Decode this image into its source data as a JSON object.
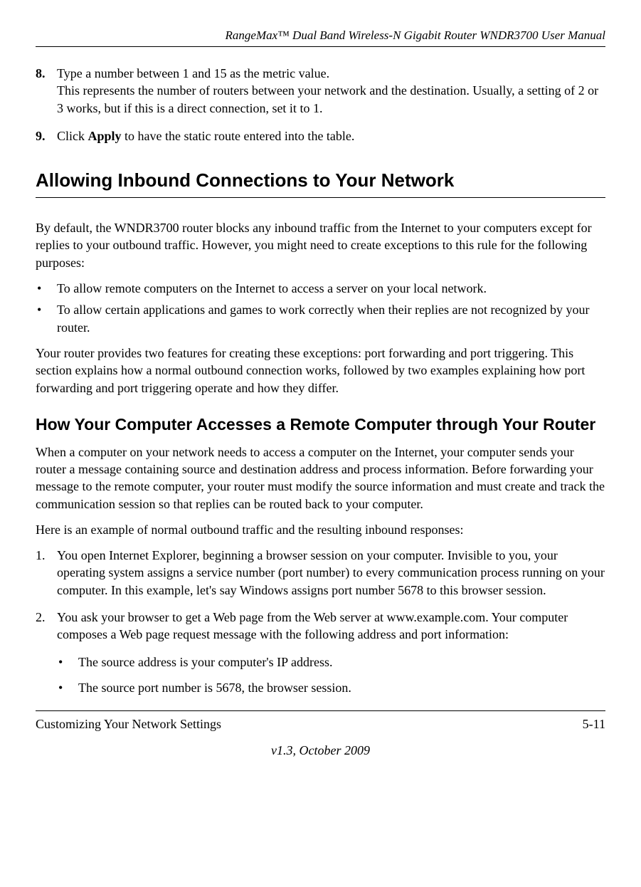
{
  "header": {
    "title": "RangeMax™ Dual Band Wireless-N Gigabit Router WNDR3700 User Manual"
  },
  "steps": {
    "eight": {
      "num": "8.",
      "text": "Type a number between 1 and 15 as the metric value.\nThis represents the number of routers between your network and the destination. Usually, a setting of 2 or 3 works, but if this is a direct connection, set it to 1."
    },
    "nine": {
      "num": "9.",
      "prefix": "Click ",
      "bold": "Apply",
      "suffix": " to have the static route entered into the table."
    }
  },
  "heading1": "Allowing Inbound Connections to Your Network",
  "para1": "By default, the WNDR3700 router blocks any inbound traffic from the Internet to your computers except for replies to your outbound traffic. However, you might need to create exceptions to this rule for the following purposes:",
  "bullets": {
    "b1": "To allow remote computers on the Internet to access a server on your local network.",
    "b2": "To allow certain applications and games to work correctly when their replies are not recognized by your router."
  },
  "para2": "Your router provides two features for creating these exceptions: port forwarding and port triggering. This section explains how a normal outbound connection works, followed by two examples explaining how port forwarding and port triggering operate and how they differ.",
  "heading2": "How Your Computer Accesses a Remote Computer through Your Router",
  "para3": "When a computer on your network needs to access a computer on the Internet, your computer sends your router a message containing source and destination address and process information. Before forwarding your message to the remote computer, your router must modify the source information and must create and track the communication session so that replies can be routed back to your computer.",
  "para4": "Here is an example of normal outbound traffic and the resulting inbound responses:",
  "olist": {
    "i1": {
      "num": "1.",
      "text": "You open Internet Explorer, beginning a browser session on your computer. Invisible to you, your operating system assigns a service number (port number) to every communication process running on your computer. In this example, let's say Windows assigns port number 5678 to this browser session."
    },
    "i2": {
      "num": "2.",
      "text": "You ask your browser to get a Web page from the Web server at www.example.com. Your computer composes a Web page request message with the following address and port information:"
    }
  },
  "subbullets": {
    "s1": "The source address is your computer's IP address.",
    "s2": "The source port number is 5678, the browser session."
  },
  "footer": {
    "left": "Customizing Your Network Settings",
    "right": "5-11",
    "version": "v1.3, October 2009"
  }
}
